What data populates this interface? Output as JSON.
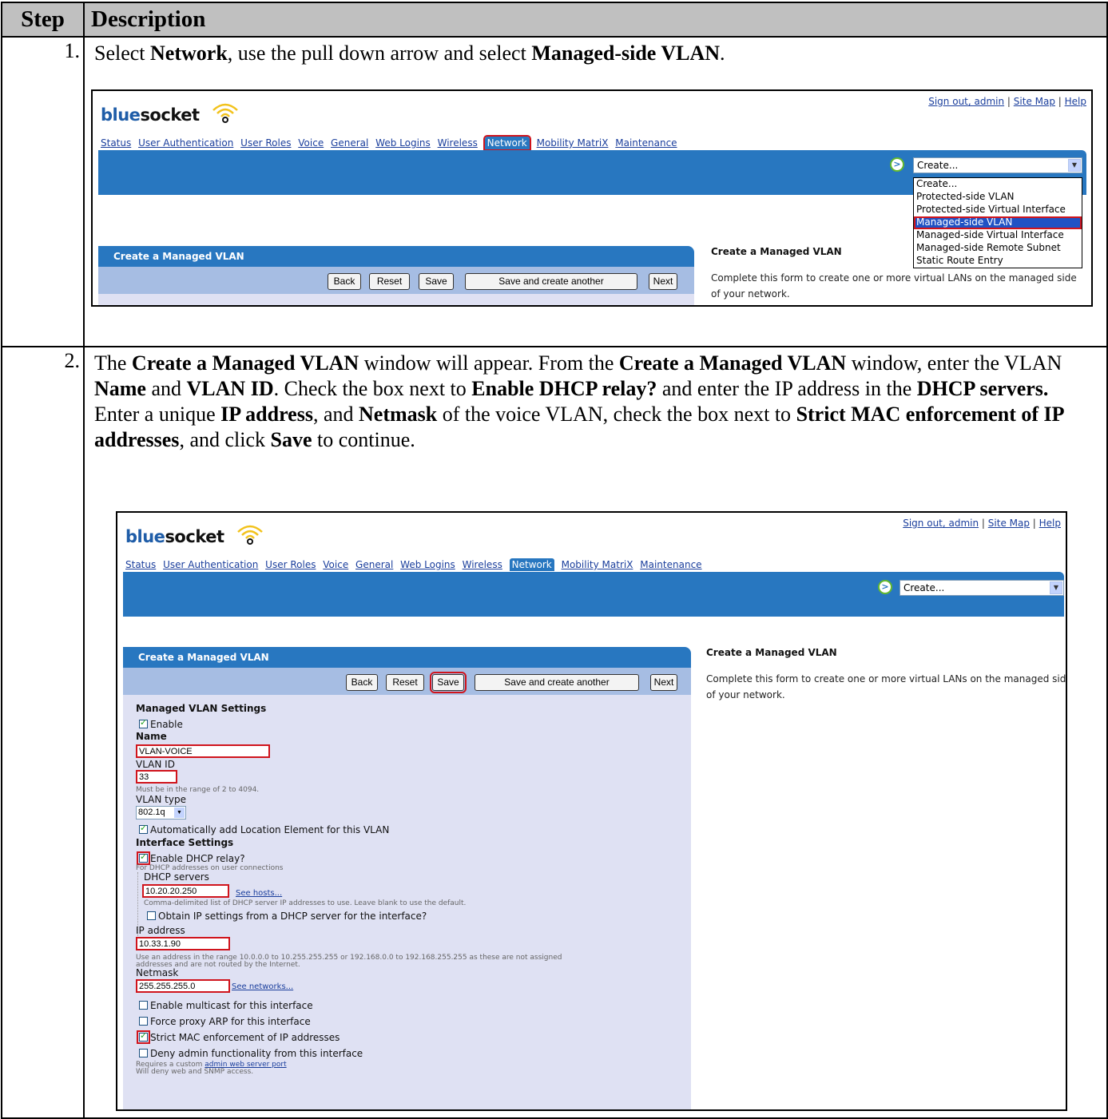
{
  "table": {
    "header_step": "Step",
    "header_description": "Description"
  },
  "step1": {
    "number": "1.",
    "desc_parts": [
      "Select ",
      "Network",
      ", use the pull down arrow and select ",
      "Managed-side VLAN",
      "."
    ]
  },
  "step2": {
    "number": "2.",
    "desc_parts": [
      "The ",
      "Create a Managed VLAN",
      " window will appear. From the ",
      "Create a Managed VLAN",
      " window, enter the VLAN ",
      "Name",
      " and ",
      "VLAN ID",
      ". Check the box next to ",
      "Enable DHCP relay?",
      " and enter the IP address in the ",
      "DHCP servers.",
      " Enter a unique ",
      "IP address",
      ", and ",
      "Netmask",
      " of the voice VLAN, check the box next to ",
      "Strict MAC enforcement of IP addresses",
      ", and click ",
      "Save",
      " to continue."
    ]
  },
  "app": {
    "logo_blue": "blue",
    "logo_dark": "socket",
    "sign_out": "Sign out, admin",
    "site_map": "Site Map",
    "help": "Help",
    "sep": " | ",
    "nav": [
      "Status",
      "User Authentication",
      "User Roles",
      "Voice",
      "General",
      "Web Logins",
      "Wireless",
      "Network",
      "Mobility MatriX",
      "Maintenance"
    ],
    "go_icon": "arrow-circle-icon",
    "create_select": "Create...",
    "dropdown_options": [
      "Create...",
      "Protected-side VLAN",
      "Protected-side Virtual Interface",
      "Managed-side VLAN",
      "Managed-side Virtual Interface",
      "Managed-side Remote Subnet",
      "Static Route Entry"
    ],
    "panel_title": "Create a Managed VLAN",
    "buttons": {
      "back": "Back",
      "reset": "Reset",
      "save": "Save",
      "save_another": "Save and create another",
      "next": "Next"
    },
    "info_title": "Create a Managed VLAN",
    "info_text": "Complete this form to create one or more virtual LANs on the managed side of your network."
  },
  "form": {
    "section_settings": "Managed VLAN Settings",
    "enable": "Enable",
    "name_label": "Name",
    "name_value": "VLAN-VOICE",
    "vlan_id_label": "VLAN ID",
    "vlan_id_value": "33",
    "vlan_id_hint": "Must be in the range of 2 to 4094.",
    "vlan_type_label": "VLAN type",
    "vlan_type_value": "802.1q",
    "auto_location": "Automatically add Location Element for this VLAN",
    "section_interface": "Interface Settings",
    "dhcp_relay": "Enable DHCP relay?",
    "dhcp_relay_hint": "For DHCP addresses on user connections",
    "dhcp_servers_label": "DHCP servers",
    "dhcp_servers_value": "10.20.20.250",
    "see_hosts": "See hosts...",
    "dhcp_servers_hint": "Comma-delimited list of DHCP server IP addresses to use. Leave blank to use the default.",
    "obtain_ip": "Obtain IP settings from a DHCP server for the interface?",
    "ip_label": "IP address",
    "ip_value": "10.33.1.90",
    "ip_hint1": "Use an address in the range 10.0.0.0 to 10.255.255.255 or 192.168.0.0 to 192.168.255.255 as these are not assigned",
    "ip_hint2": "addresses and are not routed by the Internet.",
    "netmask_label": "Netmask",
    "netmask_value": "255.255.255.0",
    "see_networks": "See networks...",
    "multicast": "Enable multicast for this interface",
    "proxy_arp": "Force proxy ARP for this interface",
    "strict_mac": "Strict MAC enforcement of IP addresses",
    "deny_admin": "Deny admin functionality from this interface",
    "requires_prefix": "Requires a custom ",
    "admin_port_link": "admin web server port",
    "deny_hint": "Will deny web and SNMP access."
  },
  "colors": {
    "accent_blue": "#2877c0",
    "highlight_red": "#d0141c",
    "form_bg": "#dfe1f3",
    "button_row": "#a6bde3"
  }
}
